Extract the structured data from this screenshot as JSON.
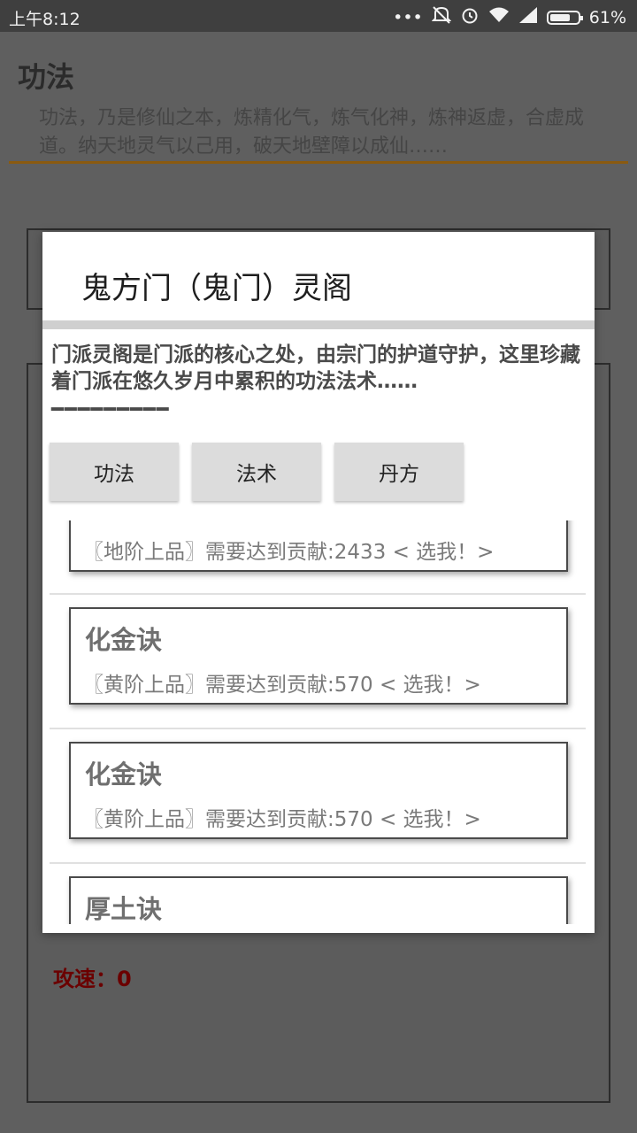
{
  "status_bar": {
    "time": "上午8:12",
    "battery": "61%",
    "icons": [
      "more-icon",
      "mute-icon",
      "alarm-icon",
      "wifi-icon",
      "signal-icon",
      "battery-icon"
    ]
  },
  "page": {
    "title": "功法",
    "description": "功法，乃是修仙之本，炼精化气，炼气化神，炼神返虚，合虚成道。纳天地灵气以己用，破天地壁障以成仙……",
    "attack_speed": "攻速：0"
  },
  "dialog": {
    "title": "鬼方门（鬼门）灵阁",
    "description": "门派灵阁是门派的核心之处，由宗门的护道守护，这里珍藏着门派在悠久岁月中累积的功法法术……",
    "dashes": "━━━━━━━━━",
    "tabs": [
      {
        "label": "功法"
      },
      {
        "label": "法术"
      },
      {
        "label": "丹方"
      }
    ],
    "items": [
      {
        "name": "",
        "requirement": "〖地阶上品〗需要达到贡献:2433  < 选我！>"
      },
      {
        "name": "化金诀",
        "requirement": "〖黄阶上品〗需要达到贡献:570  < 选我！>"
      },
      {
        "name": "化金诀",
        "requirement": "〖黄阶上品〗需要达到贡献:570  < 选我！>"
      },
      {
        "name": "厚土诀",
        "requirement": ""
      }
    ]
  },
  "colors": {
    "accent_line": "#8a5a10",
    "attack_speed": "#6b0000"
  }
}
